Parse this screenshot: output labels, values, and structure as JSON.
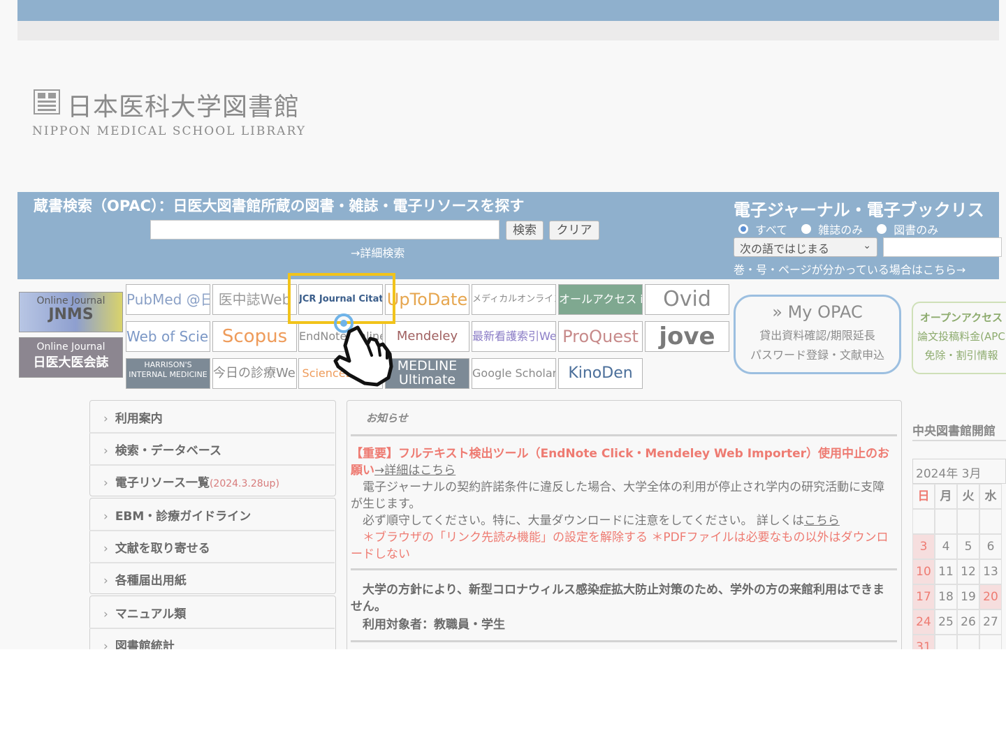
{
  "header": {
    "logo_jp": "日本医科大学図書館",
    "logo_en": "NIPPON MEDICAL SCHOOL LIBRARY"
  },
  "opac": {
    "title": "蔵書検索（OPAC）：日医大図書館所蔵の図書・雑誌・電子リソースを探す",
    "search_value": "",
    "search_button": "検索",
    "clear_button": "クリア",
    "advanced_link": "→詳細検索"
  },
  "ejournal": {
    "title": "電子ジャーナル・電子ブックリス",
    "radios": [
      {
        "label": "すべて",
        "selected": true
      },
      {
        "label": "雑誌のみ",
        "selected": false
      },
      {
        "label": "図書のみ",
        "selected": false
      }
    ],
    "match_select": "次の語ではじまる",
    "note": "巻・号・ページが分かっている場合はこちら→"
  },
  "banners": {
    "jnms": {
      "line1": "Online Journal",
      "line2": "JNMS"
    },
    "nichii": {
      "line1": "Online Journal",
      "line2": "日医大医会誌"
    }
  },
  "databases": {
    "row1": [
      "PubMed @日医大",
      "医中誌Web",
      "JCR Journal Citation Reports",
      "UpToDate",
      "メディカルオンライン MedicalOnline",
      "オールアクセス isho.jp",
      "Ovid"
    ],
    "row2": [
      "Web of Science",
      "Scopus",
      "EndNote Online",
      "Mendeley",
      "最新看護索引Web",
      "ProQuest",
      "jove"
    ],
    "row3": [
      "HARRISON'S INTERNAL MEDICINE",
      "今日の診療Web",
      "ScienceDirect",
      "MEDLINE Ultimate",
      "Google Scholar",
      "KinoDen"
    ]
  },
  "myopac": {
    "title": "» My OPAC",
    "line1": "貸出資料確認/期限延長",
    "line2": "パスワード登録・文献申込"
  },
  "open_access": {
    "line1": "オープンアクセス",
    "line2": "論文投稿料金(APC",
    "line3": "免除・割引情報"
  },
  "sidebar": {
    "items": [
      {
        "label": "利用案内",
        "suffix": ""
      },
      {
        "label": "検索・データベース",
        "suffix": ""
      },
      {
        "label": "電子リソース一覧",
        "suffix": "(2024.3.28up)"
      },
      {
        "label": "EBM・診療ガイドライン",
        "suffix": ""
      },
      {
        "label": "文献を取り寄せる",
        "suffix": ""
      },
      {
        "label": "各種届出用紙",
        "suffix": ""
      },
      {
        "label": "マニュアル類",
        "suffix": ""
      },
      {
        "label": "図書館統計",
        "suffix": ""
      }
    ]
  },
  "news": {
    "heading": "お知らせ",
    "notice1_title": "【重要】フルテキスト検出ツール（EndNote Click・Mendeley Web Importer）使用中止のお願い",
    "notice1_link": "→詳細はこちら",
    "notice1_body1": "　電子ジャーナルの契約許諾条件に違反した場合、大学全体の利用が停止され学内の研究活動に支障が生じます。",
    "notice1_body2": "　必ず順守してください。特に、大量ダウンロードに注意をしてください。 詳しくは",
    "notice1_body2_link": "こちら",
    "notice1_body3": "　＊ブラウザの「リンク先読み機能」の設定を解除する ＊PDFファイルは必要なもの以外はダウンロードしない",
    "notice2_body1": "　大学の方針により、新型コロナウィルス感染症拡大防止対策のため、学外の方の来館利用はできません。",
    "notice2_body2": "　利用対象者：教職員・学生"
  },
  "calendar": {
    "title": "中央図書館開館",
    "month": "2024年 3月",
    "weekdays": [
      "日",
      "月",
      "火",
      "水"
    ],
    "weeks": [
      [
        "",
        "",
        "",
        ""
      ],
      [
        "3",
        "4",
        "5",
        "6"
      ],
      [
        "10",
        "11",
        "12",
        "13"
      ],
      [
        "17",
        "18",
        "19",
        "20"
      ],
      [
        "24",
        "25",
        "26",
        "27"
      ],
      [
        "31",
        "",
        "",
        ""
      ]
    ]
  },
  "colors": {
    "band": "#8fb0cd",
    "highlight": "#f1c31b",
    "notice_red": "#ee7b72",
    "myopac_border": "#9cbfe0"
  },
  "icons": {
    "cursor": "pointing-hand-cursor-icon",
    "logo": "library-seal-icon"
  }
}
